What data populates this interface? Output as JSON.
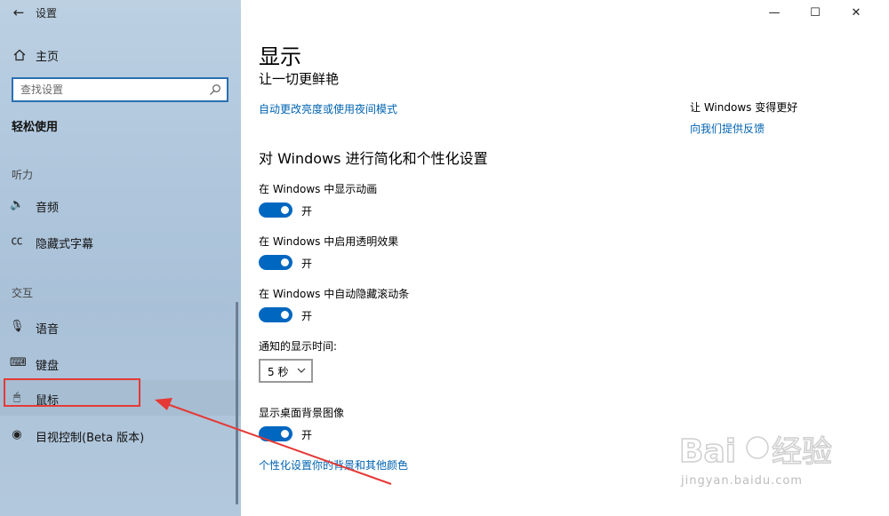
{
  "window": {
    "title": "设置",
    "controls": {
      "minimize": "—",
      "maximize": "☐",
      "close": "✕"
    }
  },
  "sidebar": {
    "back_icon": "←",
    "home_label": "主页",
    "search_placeholder": "查找设置",
    "section_title": "轻松使用",
    "groups": {
      "hearing": "听力",
      "interaction": "交互"
    },
    "items": [
      {
        "label": "音频",
        "icon": "speaker-icon",
        "glyph": "🔈"
      },
      {
        "label": "隐藏式字幕",
        "icon": "captions-icon",
        "glyph": "㏄"
      },
      {
        "label": "语音",
        "icon": "microphone-icon",
        "glyph": "🎙"
      },
      {
        "label": "键盘",
        "icon": "keyboard-icon",
        "glyph": "⌨"
      },
      {
        "label": "鼠标",
        "icon": "mouse-icon",
        "glyph": "🖱"
      },
      {
        "label": "目视控制(Beta 版本)",
        "icon": "eye-control-icon",
        "glyph": "◉"
      }
    ],
    "active_item": "鼠标"
  },
  "main": {
    "title": "显示",
    "subtitle": "让一切更鲜艳",
    "link_brightness": "自动更改亮度或使用夜间模式",
    "section_heading": "对 Windows 进行简化和个性化设置",
    "options": [
      {
        "label": "在 Windows 中显示动画",
        "state": "开",
        "on": true
      },
      {
        "label": "在 Windows 中启用透明效果",
        "state": "开",
        "on": true
      },
      {
        "label": "在 Windows 中自动隐藏滚动条",
        "state": "开",
        "on": true
      }
    ],
    "notification": {
      "label": "通知的显示时间:",
      "selected": "5 秒"
    },
    "background": {
      "label": "显示桌面背景图像",
      "state": "开",
      "on": true
    },
    "link_personalize": "个性化设置你的背景和其他颜色"
  },
  "aside": {
    "title": "让 Windows 变得更好",
    "feedback_link": "向我们提供反馈"
  },
  "watermark": {
    "text": "jingyan.baidu.com"
  },
  "colors": {
    "accent": "#0067c0",
    "link": "#0063b1",
    "annotation": "#e53935"
  }
}
